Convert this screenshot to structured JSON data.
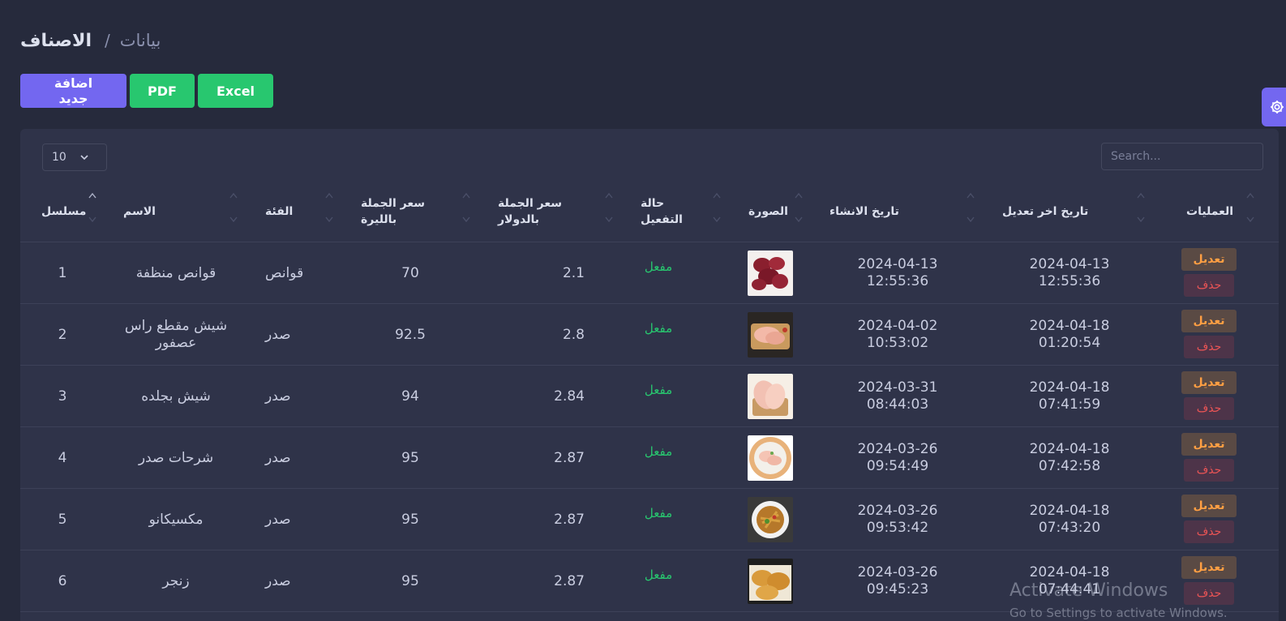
{
  "breadcrumb": {
    "parent": "بيانات",
    "separator": "/",
    "title": "الاصناف"
  },
  "toolbar": {
    "add_label": "اضافة جديد",
    "pdf_label": "PDF",
    "excel_label": "Excel"
  },
  "table_controls": {
    "page_length": "10",
    "search_placeholder": "Search..."
  },
  "columns": {
    "serial": "مسلسل",
    "name": "الاسم",
    "category": "الفئة",
    "price_lira_1": "سعر الجملة",
    "price_lira_2": "بالليرة",
    "price_usd_1": "سعر الجملة",
    "price_usd_2": "بالدولار",
    "status_1": "حالة",
    "status_2": "التفعيل",
    "image": "الصورة",
    "created": "تاريخ الانشاء",
    "updated": "تاريخ اخر تعديل",
    "operations": "العمليات"
  },
  "rows": [
    {
      "serial": "1",
      "name": "قوانص منظفة",
      "category": "قوانص",
      "price_lira": "70",
      "price_usd": "2.1",
      "status": "مفعل",
      "image_icon": "gizzards-photo",
      "created_date": "2024-04-13",
      "created_time": "12:55:36",
      "updated_date": "2024-04-13",
      "updated_time": "12:55:36",
      "edit": "تعديل",
      "delete": "حذف"
    },
    {
      "serial": "2",
      "name": "شيش مقطع راس عصفور",
      "category": "صدر",
      "price_lira": "92.5",
      "price_usd": "2.8",
      "status": "مفعل",
      "image_icon": "cut-chicken-photo",
      "created_date": "2024-04-02",
      "created_time": "10:53:02",
      "updated_date": "2024-04-18",
      "updated_time": "01:20:54",
      "edit": "تعديل",
      "delete": "حذف"
    },
    {
      "serial": "3",
      "name": "شيش بجلده",
      "category": "صدر",
      "price_lira": "94",
      "price_usd": "2.84",
      "status": "مفعل",
      "image_icon": "chicken-breast-photo",
      "created_date": "2024-03-31",
      "created_time": "08:44:03",
      "updated_date": "2024-04-18",
      "updated_time": "07:41:59",
      "edit": "تعديل",
      "delete": "حذف"
    },
    {
      "serial": "4",
      "name": "شرحات صدر",
      "category": "صدر",
      "price_lira": "95",
      "price_usd": "2.87",
      "status": "مفعل",
      "image_icon": "breast-slices-photo",
      "created_date": "2024-03-26",
      "created_time": "09:54:49",
      "updated_date": "2024-04-18",
      "updated_time": "07:42:58",
      "edit": "تعديل",
      "delete": "حذف"
    },
    {
      "serial": "5",
      "name": "مكسيكانو",
      "category": "صدر",
      "price_lira": "95",
      "price_usd": "2.87",
      "status": "مفعل",
      "image_icon": "mexicano-dish-photo",
      "created_date": "2024-03-26",
      "created_time": "09:53:42",
      "updated_date": "2024-04-18",
      "updated_time": "07:43:20",
      "edit": "تعديل",
      "delete": "حذف"
    },
    {
      "serial": "6",
      "name": "زنجر",
      "category": "صدر",
      "price_lira": "95",
      "price_usd": "2.87",
      "status": "مفعل",
      "image_icon": "zinger-photo",
      "created_date": "2024-03-26",
      "created_time": "09:45:23",
      "updated_date": "2024-04-18",
      "updated_time": "07:44:41",
      "edit": "تعديل",
      "delete": "حذف"
    }
  ],
  "watermark": {
    "line1": "Activate Windows",
    "line2": "Go to Settings to activate Windows."
  },
  "colors": {
    "primary": "#7367f0",
    "success": "#28c76f",
    "warning": "#ff9f43",
    "danger": "#ea5455",
    "background": "#262a3c",
    "card": "#2f3349"
  }
}
